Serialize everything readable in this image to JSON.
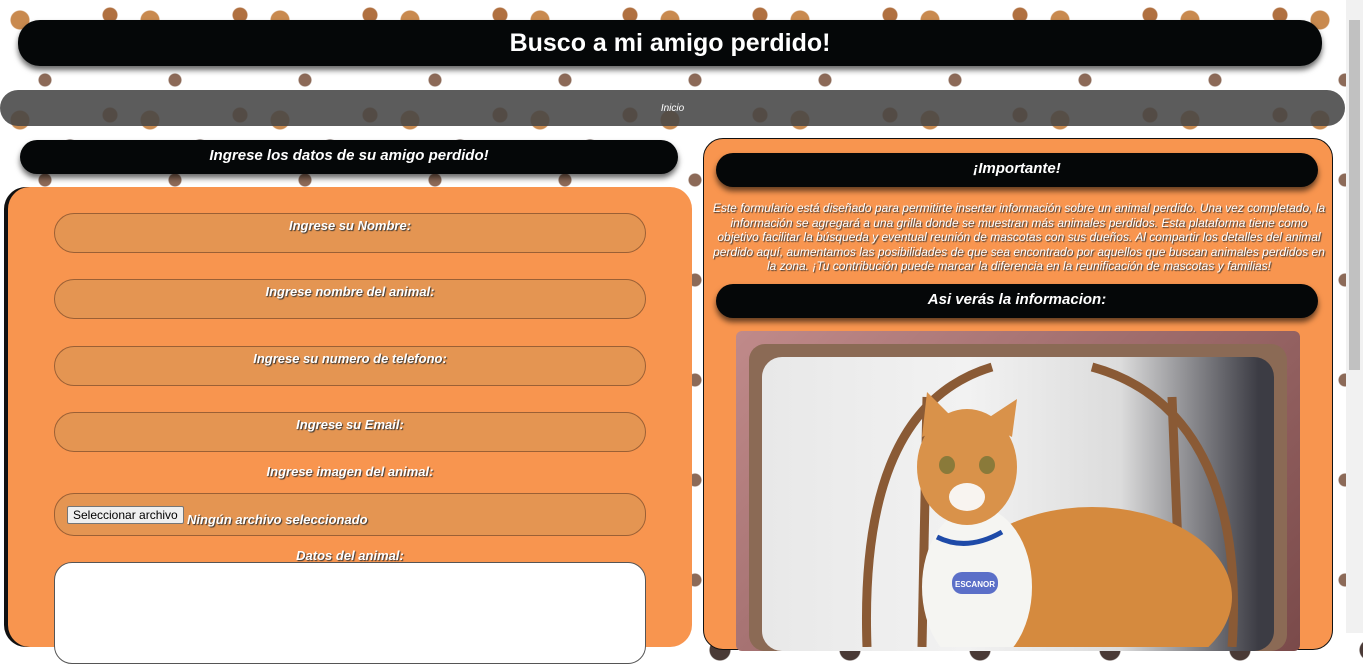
{
  "header": {
    "title": "Busco a mi amigo perdido!"
  },
  "nav": {
    "items": [
      {
        "label": "Inicio"
      }
    ]
  },
  "form": {
    "heading": "Ingrese los datos de su amigo perdido!",
    "fields": [
      {
        "label": "Ingrese su Nombre:",
        "value": ""
      },
      {
        "label": "Ingrese nombre del animal:",
        "value": ""
      },
      {
        "label": "Ingrese su numero de telefono:",
        "value": ""
      },
      {
        "label": "Ingrese su Email:",
        "value": ""
      }
    ],
    "image_label": "Ingrese imagen del animal:",
    "file_button": "Seleccionar archivo",
    "file_status": "Ningún archivo seleccionado",
    "details_label": "Datos del animal:",
    "details_value": ""
  },
  "info": {
    "heading": "¡Importante!",
    "text": "Este formulario está diseñado para permitirte insertar información sobre un animal perdido. Una vez completado, la información se agregará a una grilla donde se muestran más animales perdidos. Esta plataforma tiene como objetivo facilitar la búsqueda y eventual reunión de mascotas con sus dueños. Al compartir los detalles del animal perdido aquí, aumentamos las posibilidades de que sea encontrado por aquellos que buscan animales perdidos en la zona. ¡Tu contribución puede marcar la diferencia en la reunificación de mascotas y familias!",
    "example_heading": "Asi verás la informacion:",
    "tag_text": "ESCANOR"
  },
  "colors": {
    "panel": "#f8954f",
    "bar": "#050708",
    "field": "#e49552"
  }
}
